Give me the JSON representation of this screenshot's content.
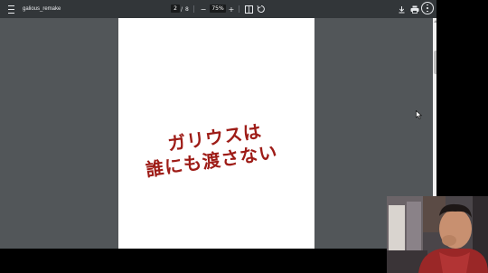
{
  "toolbar": {
    "title": "galious_remake",
    "current_page": "2",
    "page_separator": "/",
    "total_pages": "8",
    "zoom_minus": "−",
    "zoom_level": "75%",
    "zoom_plus": "+"
  },
  "document": {
    "line1": "ガリウスは",
    "line2": "誰にも渡さない"
  },
  "colors": {
    "toolbar_bg": "#323639",
    "viewer_bg": "#525659",
    "text_red": "#9e1c17"
  },
  "icons": [
    "menu-icon",
    "fit-page-icon",
    "rotate-icon",
    "download-icon",
    "print-icon",
    "more-vert-icon"
  ]
}
